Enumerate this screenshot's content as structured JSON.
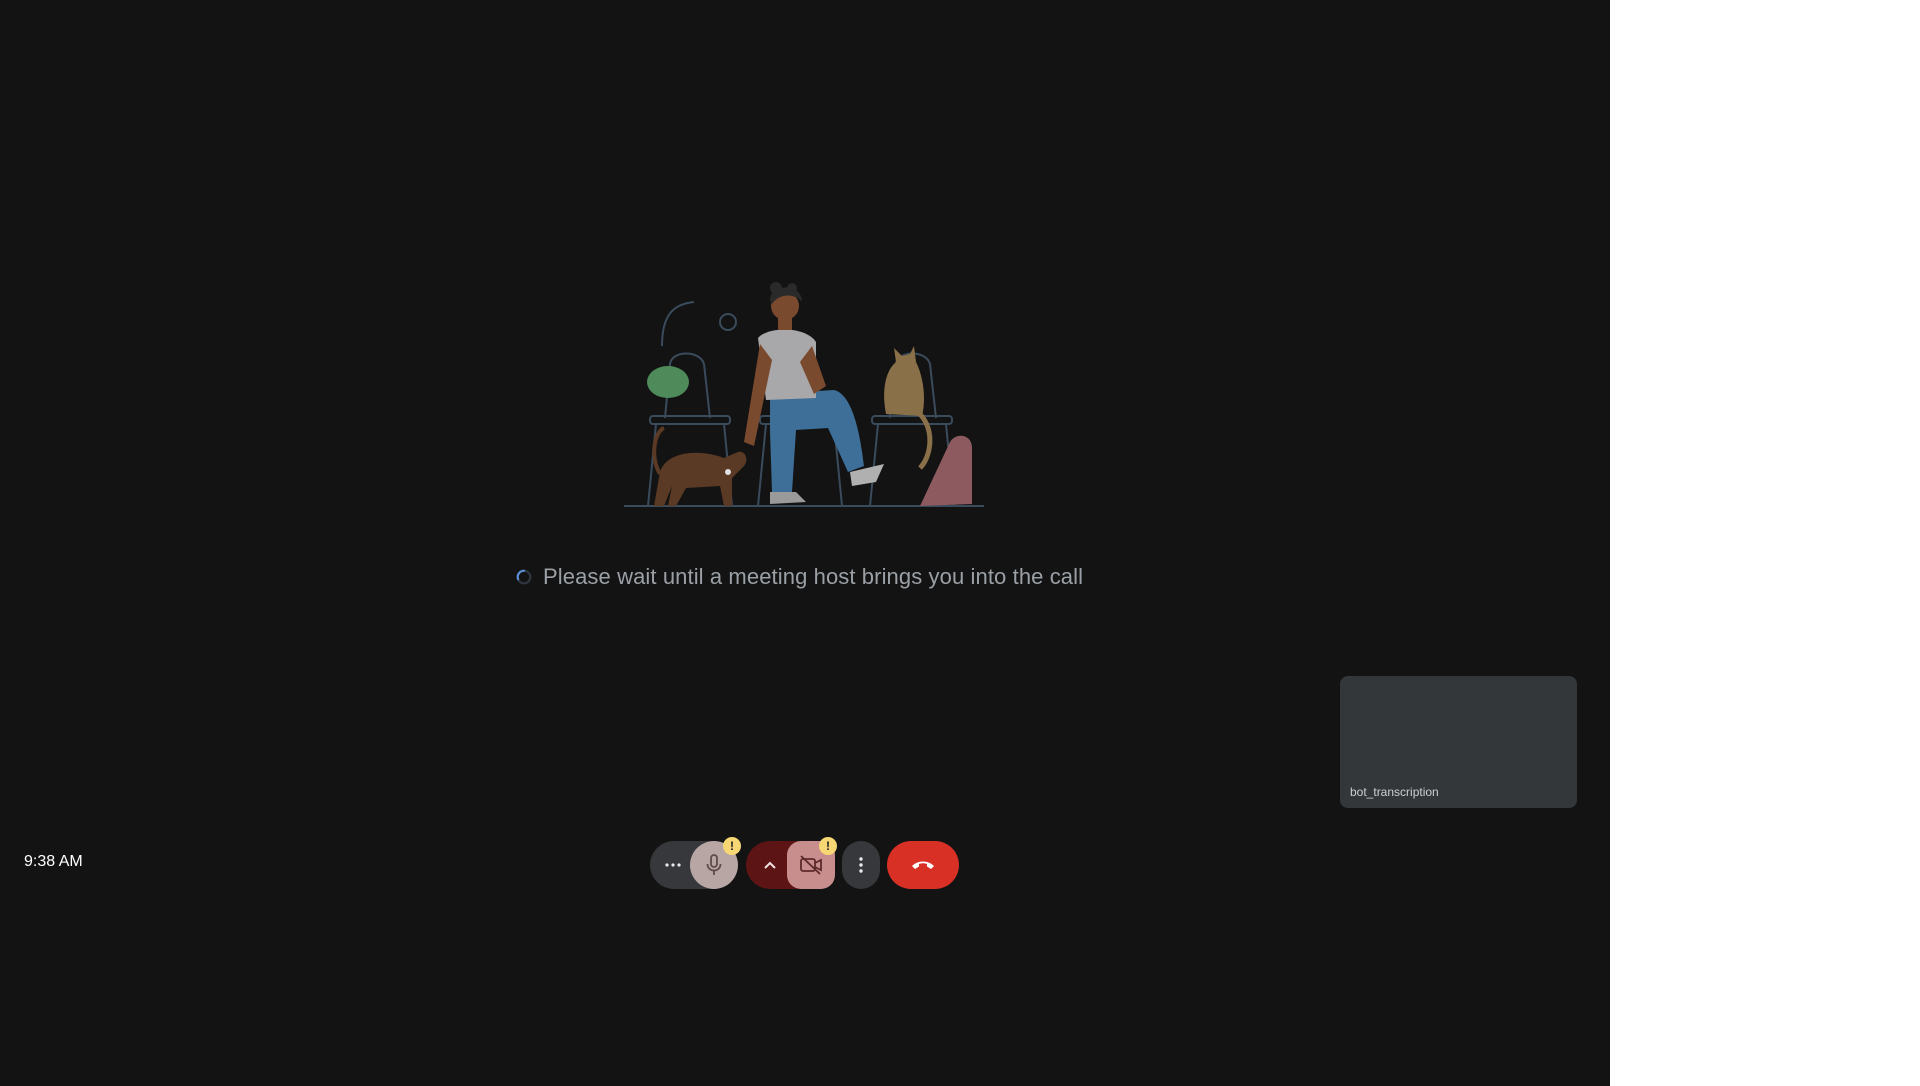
{
  "waiting": {
    "message": "Please wait until a meeting host brings you into the call"
  },
  "self_view": {
    "participant_name": "bot_transcription"
  },
  "status": {
    "time": "9:38 AM"
  },
  "controls": {
    "mic_alert": "!",
    "camera_alert": "!"
  },
  "colors": {
    "stage_background": "#131313",
    "leave_button": "#d93025",
    "alert_badge": "#f7d774",
    "camera_off": "#c88d8d",
    "mic_muted": "#b8a6a5"
  }
}
